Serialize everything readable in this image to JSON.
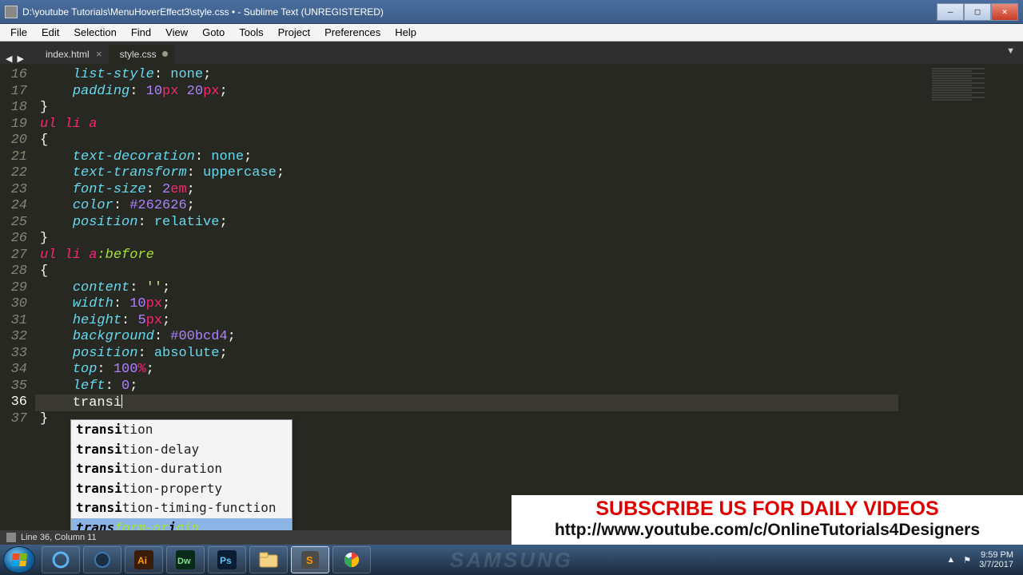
{
  "window": {
    "title": "D:\\youtube Tutorials\\MenuHoverEffect3\\style.css • - Sublime Text (UNREGISTERED)"
  },
  "menu": [
    "File",
    "Edit",
    "Selection",
    "Find",
    "View",
    "Goto",
    "Tools",
    "Project",
    "Preferences",
    "Help"
  ],
  "tabs": [
    {
      "label": "index.html",
      "active": false,
      "dirty": false
    },
    {
      "label": "style.css",
      "active": true,
      "dirty": true
    }
  ],
  "gutter_start": 16,
  "gutter_count": 22,
  "current_line": 36,
  "code": {
    "typed_token": "transi"
  },
  "autocomplete": {
    "selected_index": 5,
    "items": [
      {
        "bold": "transi",
        "rest": "tion"
      },
      {
        "bold": "transi",
        "rest": "tion-delay"
      },
      {
        "bold": "transi",
        "rest": "tion-duration"
      },
      {
        "bold": "transi",
        "rest": "tion-property"
      },
      {
        "bold": "transi",
        "rest": "tion-timing-function"
      },
      {
        "bold": "trans",
        "mid": "form-or",
        "bold2": "i",
        "rest": "gin"
      }
    ]
  },
  "status": "Line 36, Column 11",
  "banner": {
    "line1": "SUBSCRIBE US FOR DAILY VIDEOS",
    "line2": "http://www.youtube.com/c/OnlineTutorials4Designers"
  },
  "tray": {
    "time": "9:59 PM",
    "date": "3/7/2017"
  },
  "watermark": "SAMSUNG",
  "code_lines": [
    {
      "n": 16,
      "html": "    <span class='prop'>list-style</span><span class='punc'>:</span> <span class='val'>none</span><span class='punc'>;</span>"
    },
    {
      "n": 17,
      "html": "    <span class='prop'>padding</span><span class='punc'>:</span> <span class='num'>10</span><span class='unit'>px</span> <span class='num'>20</span><span class='unit'>px</span><span class='punc'>;</span>"
    },
    {
      "n": 18,
      "html": "<span class='punc'>}</span>"
    },
    {
      "n": 19,
      "html": "<span class='tag'>ul</span> <span class='tag'>li</span> <span class='tag'>a</span>"
    },
    {
      "n": 20,
      "html": "<span class='punc'>{</span>"
    },
    {
      "n": 21,
      "html": "    <span class='prop'>text-decoration</span><span class='punc'>:</span> <span class='val'>none</span><span class='punc'>;</span>"
    },
    {
      "n": 22,
      "html": "    <span class='prop'>text-transform</span><span class='punc'>:</span> <span class='val'>uppercase</span><span class='punc'>;</span>"
    },
    {
      "n": 23,
      "html": "    <span class='prop'>font-size</span><span class='punc'>:</span> <span class='num'>2</span><span class='unit'>em</span><span class='punc'>;</span>"
    },
    {
      "n": 24,
      "html": "    <span class='prop'>color</span><span class='punc'>:</span> <span class='hex'>#262626</span><span class='punc'>;</span>"
    },
    {
      "n": 25,
      "html": "    <span class='prop'>position</span><span class='punc'>:</span> <span class='val'>relative</span><span class='punc'>;</span>"
    },
    {
      "n": 26,
      "html": "<span class='punc'>}</span>"
    },
    {
      "n": 27,
      "html": "<span class='tag'>ul</span> <span class='tag'>li</span> <span class='tag'>a</span><span class='sel'>:before</span>"
    },
    {
      "n": 28,
      "html": "<span class='punc'>{</span>"
    },
    {
      "n": 29,
      "html": "    <span class='prop'>content</span><span class='punc'>:</span> <span class='str'>''</span><span class='punc'>;</span>"
    },
    {
      "n": 30,
      "html": "    <span class='prop'>width</span><span class='punc'>:</span> <span class='num'>10</span><span class='unit'>px</span><span class='punc'>;</span>"
    },
    {
      "n": 31,
      "html": "    <span class='prop'>height</span><span class='punc'>:</span> <span class='num'>5</span><span class='unit'>px</span><span class='punc'>;</span>"
    },
    {
      "n": 32,
      "html": "    <span class='prop'>background</span><span class='punc'>:</span> <span class='hex'>#00bcd4</span><span class='punc'>;</span>"
    },
    {
      "n": 33,
      "html": "    <span class='prop'>position</span><span class='punc'>:</span> <span class='val'>absolute</span><span class='punc'>;</span>"
    },
    {
      "n": 34,
      "html": "    <span class='prop'>top</span><span class='punc'>:</span> <span class='num'>100</span><span class='unit'>%</span><span class='punc'>;</span>"
    },
    {
      "n": 35,
      "html": "    <span class='prop'>left</span><span class='punc'>:</span> <span class='num'>0</span><span class='punc'>;</span>"
    },
    {
      "n": 36,
      "html": "    <span class='plain' data-bind='code.typed_token'></span><span class='caret'></span>",
      "cur": true
    },
    {
      "n": 37,
      "html": "<span class='punc'>}</span>"
    }
  ]
}
